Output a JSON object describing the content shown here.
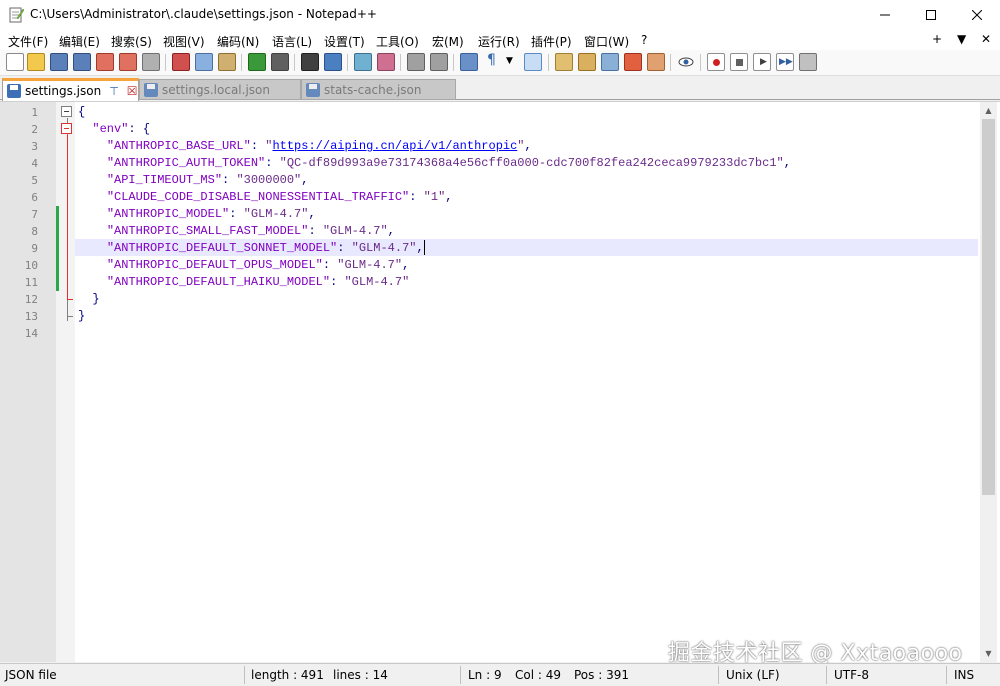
{
  "window": {
    "title": "C:\\Users\\Administrator\\.claude\\settings.json - Notepad++",
    "controls": {
      "minimize": "—",
      "maximize": "☐",
      "close": "✕"
    }
  },
  "menu": {
    "items": [
      "文件(F)",
      "编辑(E)",
      "搜索(S)",
      "视图(V)",
      "编码(N)",
      "语言(L)",
      "设置(T)",
      "工具(O)",
      "宏(M)",
      "运行(R)",
      "插件(P)",
      "窗口(W)",
      "?"
    ],
    "right": [
      "+",
      "▼",
      "✕"
    ]
  },
  "tabs": [
    {
      "label": "settings.json",
      "pin": "⊤",
      "close": "☒",
      "active": true
    },
    {
      "label": "settings.local.json",
      "active": false
    },
    {
      "label": "stats-cache.json",
      "active": false
    }
  ],
  "editor": {
    "line_numbers": [
      "1",
      "2",
      "3",
      "4",
      "5",
      "6",
      "7",
      "8",
      "9",
      "10",
      "11",
      "12",
      "13",
      "14"
    ],
    "lines": {
      "l1": {
        "punct": "{"
      },
      "l2": {
        "key": "\"env\"",
        "punct": ": {"
      },
      "l3": {
        "key": "\"ANTHROPIC_BASE_URL\"",
        "sep": ": ",
        "q1": "\"",
        "url": "https://aiping.cn/api/v1/anthropic",
        "q2": "\"",
        "tail": ","
      },
      "l4": {
        "key": "\"ANTHROPIC_AUTH_TOKEN\"",
        "sep": ": ",
        "val": "\"QC-df89d993a9e73174368a4e56cff0a000-cdc700f82fea242ceca9979233dc7bc1\"",
        "tail": ","
      },
      "l5": {
        "key": "\"API_TIMEOUT_MS\"",
        "sep": ": ",
        "val": "\"3000000\"",
        "tail": ","
      },
      "l6": {
        "key": "\"CLAUDE_CODE_DISABLE_NONESSENTIAL_TRAFFIC\"",
        "sep": ": ",
        "val": "\"1\"",
        "tail": ","
      },
      "l7": {
        "key": "\"ANTHROPIC_MODEL\"",
        "sep": ": ",
        "val": "\"GLM-4.7\"",
        "tail": ","
      },
      "l8": {
        "key": "\"ANTHROPIC_SMALL_FAST_MODEL\"",
        "sep": ": ",
        "val": "\"GLM-4.7\"",
        "tail": ","
      },
      "l9": {
        "key": "\"ANTHROPIC_DEFAULT_SONNET_MODEL\"",
        "sep": ": ",
        "val": "\"GLM-4.7\"",
        "tail": ","
      },
      "l10": {
        "key": "\"ANTHROPIC_DEFAULT_OPUS_MODEL\"",
        "sep": ": ",
        "val": "\"GLM-4.7\"",
        "tail": ","
      },
      "l11": {
        "key": "\"ANTHROPIC_DEFAULT_HAIKU_MODEL\"",
        "sep": ": ",
        "val": "\"GLM-4.7\"",
        "tail": ""
      },
      "l12": {
        "punct": "}"
      },
      "l13": {
        "punct": "}"
      }
    }
  },
  "watermark": "掘金技术社区 @ Xxtaoaooo",
  "status": {
    "file_type": "JSON file",
    "length": "length : 491",
    "lines": "lines : 14",
    "ln": "Ln : 9",
    "col": "Col : 49",
    "pos": "Pos : 391",
    "eol": "Unix (LF)",
    "encoding": "UTF-8",
    "mode": "INS"
  },
  "colors": {
    "tab_accent": "#f7a33b",
    "current_line": "#e8e8ff",
    "change_marker": "#2aa84a",
    "fold_marker": "#e03030",
    "key_color": "#8000c0",
    "url_color": "#0000ff"
  }
}
